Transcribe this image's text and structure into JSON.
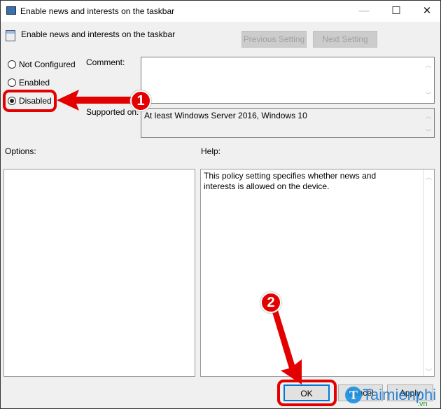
{
  "window": {
    "title": "Enable news and interests on the taskbar",
    "minimize": "—",
    "maximize": "☐",
    "close": "✕"
  },
  "header": {
    "title": "Enable news and interests on the taskbar",
    "previous_label": "Previous Setting",
    "next_label": "Next Setting"
  },
  "state": {
    "options": [
      {
        "label": "Not Configured",
        "selected": false
      },
      {
        "label": "Enabled",
        "selected": false
      },
      {
        "label": "Disabled",
        "selected": true
      }
    ]
  },
  "comment": {
    "label": "Comment:",
    "value": ""
  },
  "supported": {
    "label": "Supported on:",
    "value": "At least Windows Server 2016, Windows 10"
  },
  "options_panel": {
    "label": "Options:"
  },
  "help_panel": {
    "label": "Help:",
    "text": "This policy setting specifies whether news and interests is allowed on the device."
  },
  "footer": {
    "ok_label": "OK",
    "cancel_label": "Cancel",
    "apply_label": "Apply"
  },
  "annotations": {
    "step1": "1",
    "step2": "2",
    "color": "#e30000"
  },
  "watermark": {
    "text": "Taimienphi",
    ".vn": ".vn"
  }
}
